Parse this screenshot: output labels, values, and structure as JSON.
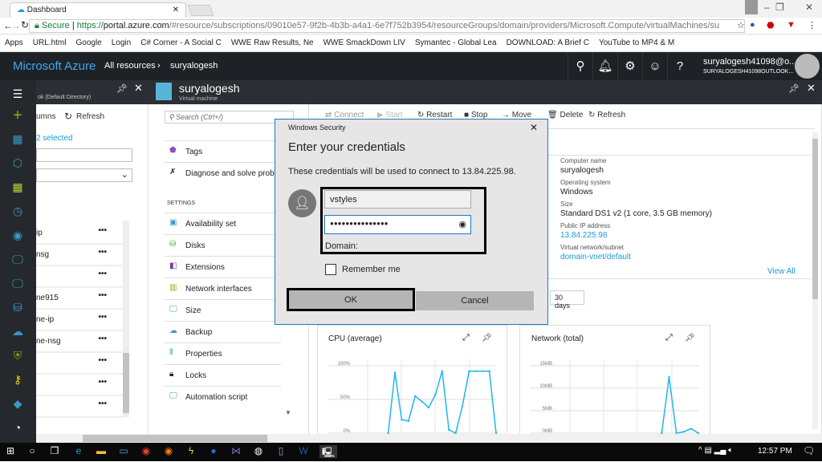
{
  "browser": {
    "tab_title": "Dashboard",
    "secure_label": "Secure",
    "url_scheme": "https://",
    "url_host": "portal.azure.com",
    "url_rest": "/#resource/subscriptions/09010e57-9f2b-4b3b-a4a1-6e7f752b3954/resourceGroups/domain/providers/Microsoft.Compute/virtualMachines/su",
    "bookmarks": [
      "Apps",
      "URL.html",
      "Google",
      "Login",
      "C# Corner - A Social C",
      "WWE Raw Results, Ne",
      "WWE SmackDown LIV",
      "Symantec - Global Lea",
      "DOWNLOAD: A Brief C",
      "YouTube to MP4 & M"
    ]
  },
  "header": {
    "brand": "Microsoft Azure",
    "crumb1": "All resources",
    "crumb2": "suryalogesh",
    "user_email": "suryalogesh41098@o...",
    "user_dir": "SURYALOGESH41098OUTLOOK..."
  },
  "blade1": {
    "subtitle": "ok (Default Directory)",
    "columns_label": "umns",
    "refresh_label": "Refresh",
    "selected_label": "2 selected",
    "rows": [
      "ip",
      "nsg",
      "",
      "ne915",
      "ne-ip",
      "ne-nsg",
      "",
      "",
      ""
    ]
  },
  "blade2": {
    "title": "suryalogesh",
    "subtitle": "Virtual machine",
    "search_placeholder": "Search (Ctrl+/)",
    "tags": "Tags",
    "diagnose": "Diagnose and solve problems",
    "settings_heading": "SETTINGS",
    "menu": [
      "Availability set",
      "Disks",
      "Extensions",
      "Network interfaces",
      "Size",
      "Backup",
      "Properties",
      "Locks",
      "Automation script"
    ]
  },
  "toolbar": {
    "connect": "Connect",
    "start": "Start",
    "restart": "Restart",
    "stop": "Stop",
    "move": "Move",
    "delete": "Delete",
    "refresh": "Refresh"
  },
  "essentials": {
    "computer_name_label": "Computer name",
    "computer_name": "suryalogesh",
    "os_label": "Operating system",
    "os": "Windows",
    "size_label": "Size",
    "size": "Standard DS1 v2 (1 core, 3.5 GB memory)",
    "ip_label": "Public IP address",
    "ip": "13.84.225.98",
    "vnet_label": "Virtual network/subnet",
    "vnet": "domain-vnet/default",
    "view_all": "View All",
    "range_30": "30 days"
  },
  "dialog": {
    "window_title": "Windows Security",
    "heading": "Enter your credentials",
    "message": "These credentials will be used to connect to 13.84.225.98.",
    "username": "vstyles",
    "password_mask": "●●●●●●●●●●●●●●●",
    "domain_label": "Domain:",
    "remember": "Remember me",
    "ok": "OK",
    "cancel": "Cancel"
  },
  "chart_data": [
    {
      "type": "line",
      "title": "CPU (average)",
      "yticks": [
        "100%",
        "50%",
        "0%"
      ],
      "ylim": [
        0,
        100
      ],
      "color": "#1fb6ef",
      "values": [
        null,
        null,
        null,
        null,
        null,
        null,
        null,
        null,
        null,
        0,
        90,
        20,
        18,
        55,
        47,
        38,
        57,
        92,
        5,
        0,
        40,
        92,
        92,
        92,
        92,
        0
      ]
    },
    {
      "type": "line",
      "title": "Network (total)",
      "yticks": [
        "15MB",
        "10MB",
        "5MB",
        "0MB"
      ],
      "ylim": [
        0,
        15
      ],
      "color": "#1fb6ef",
      "values": [
        null,
        null,
        null,
        null,
        null,
        null,
        null,
        null,
        null,
        null,
        null,
        null,
        null,
        null,
        null,
        null,
        null,
        null,
        0,
        12.5,
        0,
        0.3,
        1,
        0
      ]
    }
  ],
  "taskbar": {
    "time": "12:57 PM"
  }
}
